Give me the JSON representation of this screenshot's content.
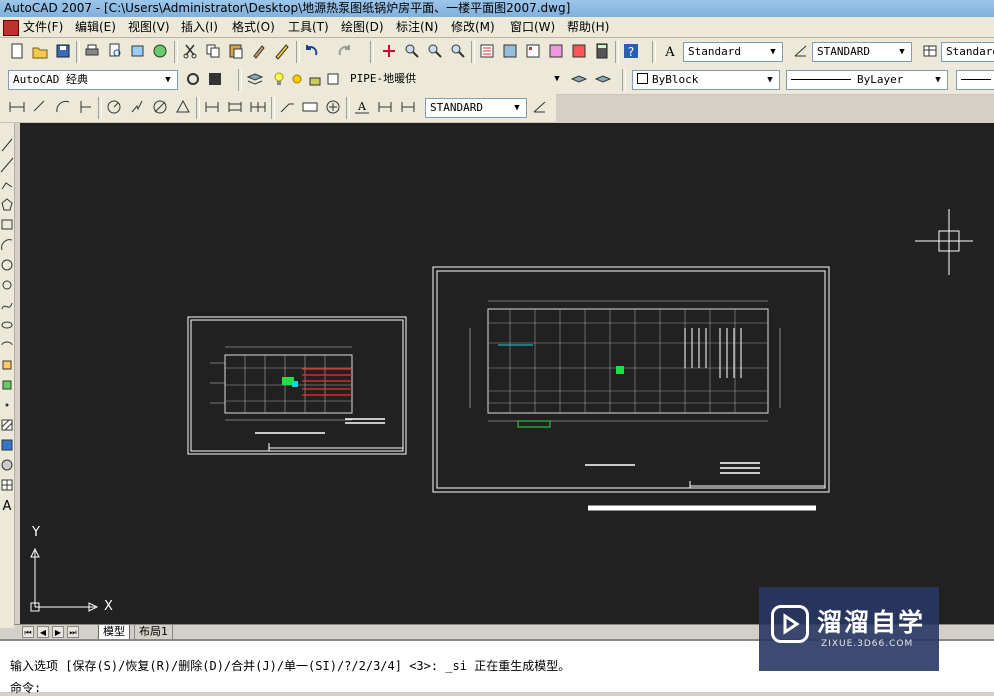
{
  "window": {
    "title": "AutoCAD 2007 - [C:\\Users\\Administrator\\Desktop\\地源热泵图纸锅炉房平面、一楼平面图2007.dwg]"
  },
  "menu": [
    "文件(F)",
    "编辑(E)",
    "视图(V)",
    "插入(I)",
    "格式(O)",
    "工具(T)",
    "绘图(D)",
    "标注(N)",
    "修改(M)",
    "窗口(W)",
    "帮助(H)"
  ],
  "toolbar1": {
    "text_style": "Standard",
    "dim_style": "STANDARD",
    "table_style": "Standard"
  },
  "toolbar2": {
    "workspace": "AutoCAD 经典",
    "layer": "PIPE-地暖供",
    "color": "ByBlock",
    "linetype": "ByLayer"
  },
  "toolbar3": {
    "dim_style": "STANDARD"
  },
  "canvas": {
    "ucs_y": "Y",
    "ucs_x": "X"
  },
  "tabs": {
    "model": "模型",
    "layout": "布局1"
  },
  "command": {
    "line1": "输入选项 [保存(S)/恢复(R)/删除(D)/合并(J)/单一(SI)/?/2/3/4] <3>: _si 正在重生成模型。",
    "line2": "命令:"
  },
  "watermark": {
    "title": "溜溜自学",
    "url": "ZIXUE.3D66.COM"
  },
  "colors": {
    "canvas": "#212121",
    "drawing": "#ffffff",
    "accent_red": "#ff2a2a",
    "accent_green": "#20e040",
    "accent_cyan": "#20d0e0"
  }
}
